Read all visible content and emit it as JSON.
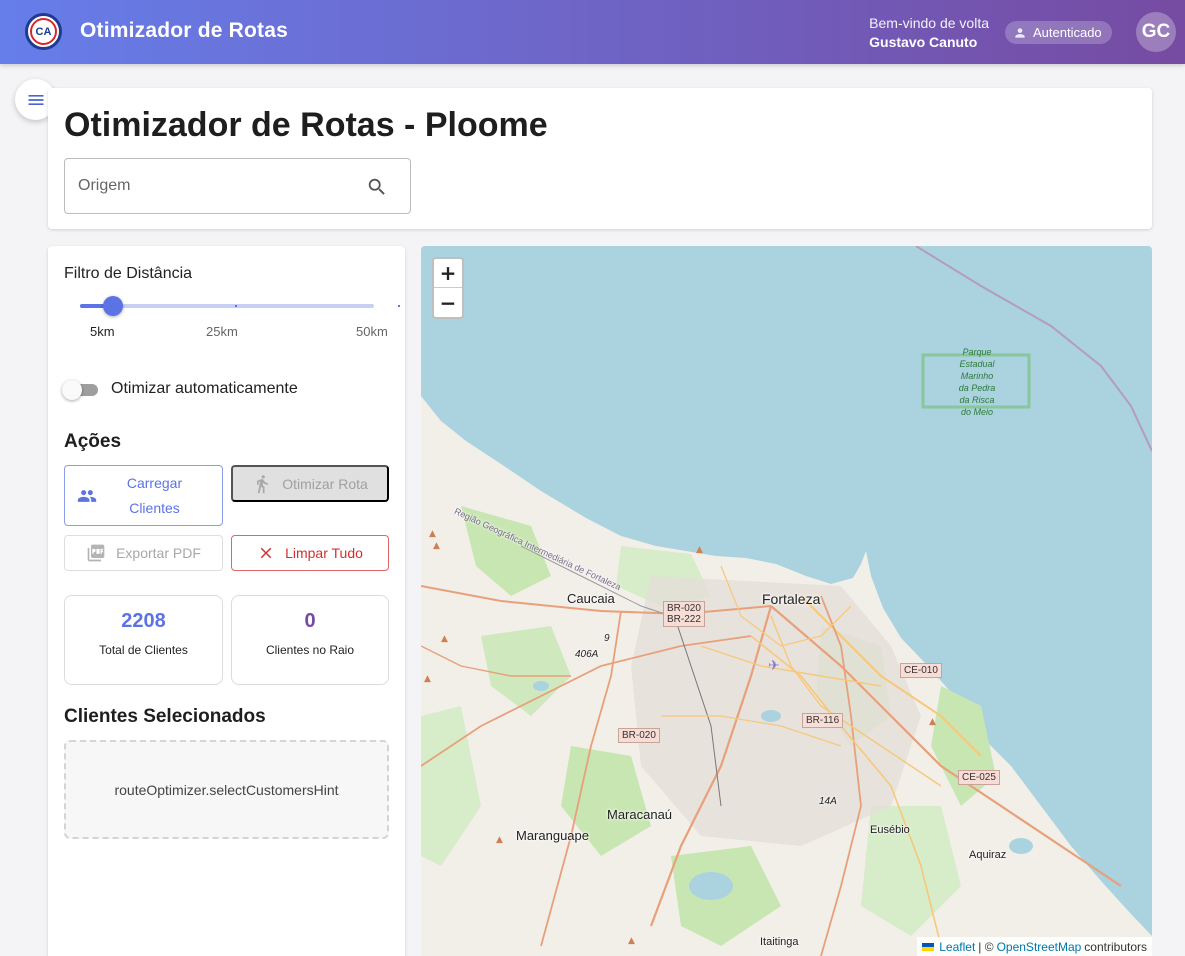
{
  "header": {
    "title": "Otimizador de Rotas",
    "welcome": "Bem-vindo de volta",
    "user_name": "Gustavo Canuto",
    "auth_chip": "Autenticado",
    "avatar_initials": "GC",
    "logo_text": "CA"
  },
  "page": {
    "title": "Otimizador de Rotas - Ploome",
    "origin_placeholder": "Origem"
  },
  "filter": {
    "label": "Filtro de Distância",
    "min": 5,
    "max": 50,
    "value": 10,
    "ticks": [
      "5km",
      "25km",
      "50km"
    ]
  },
  "auto_optimize": {
    "label": "Otimizar automaticamente",
    "enabled": false
  },
  "actions": {
    "title": "Ações",
    "load_clients": "Carregar Clientes",
    "optimize_route": "Otimizar Rota",
    "export_pdf": "Exportar PDF",
    "clear_all": "Limpar Tudo"
  },
  "stats": {
    "total_value": "2208",
    "total_label": "Total de Clientes",
    "radius_value": "0",
    "radius_label": "Clientes no Raio"
  },
  "selected": {
    "title": "Clientes Selecionados",
    "hint": "routeOptimizer.selectCustomersHint"
  },
  "map": {
    "zoom_in": "+",
    "zoom_out": "−",
    "attribution_leaflet": "Leaflet",
    "attribution_sep": "| ©",
    "attribution_osm": "OpenStreetMap",
    "attribution_tail": "contributors",
    "park_label": "Parque Estadual Marinho da Pedra da Risca do Meio",
    "region_label": "Região Geográfica Intermediária de Fortaleza",
    "places": {
      "fortaleza": "Fortaleza",
      "caucaia": "Caucaia",
      "maracanau": "Maracanaú",
      "maranguape": "Maranguape",
      "eusebio": "Eusébio",
      "aquiraz": "Aquiraz",
      "itaitinga": "Itaitinga"
    },
    "roads": {
      "br020_222_a": "BR-020",
      "br020_222_b": "BR-222",
      "br020": "BR-020",
      "br116": "BR-116",
      "ce010": "CE-010",
      "ce025": "CE-025",
      "r406a": "406A",
      "r14a": "14A",
      "r9": "9"
    },
    "colors": {
      "sea": "#aad3df",
      "land": "#f2efe9",
      "green": "#c8e6b2",
      "road_major": "#e8a07a",
      "road_trunk": "#f7c87a"
    }
  }
}
